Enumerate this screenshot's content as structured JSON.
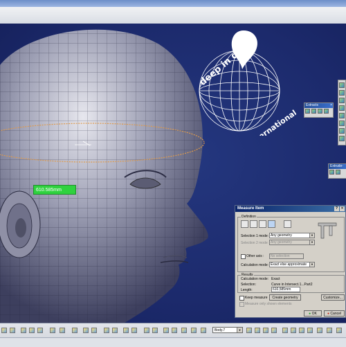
{
  "viewport": {
    "measure_tag": "610.585mm",
    "logo": {
      "text_top": "deep in dis",
      "text_bottom": "international"
    }
  },
  "toolbars": {
    "extracts": {
      "title": "Extracts"
    },
    "extrude": {
      "title": "Extrude-"
    }
  },
  "dialog": {
    "title": "Measure Item",
    "help_button": "?",
    "close_button": "×",
    "definition": {
      "label": "Definition",
      "selection1_mode_label": "Selection 1 mode:",
      "selection1_mode_value": "Any geometry",
      "selection2_mode_label": "Selection 2 mode:",
      "selection2_mode_value": "Any geometry",
      "other_axis_label": "Other axis :",
      "other_axis_value": "No selection",
      "calculation_mode_label": "Calculation mode:",
      "calculation_mode_value": "Exact else approximate"
    },
    "results": {
      "label": "Results",
      "calc_mode_label": "Calculation mode:",
      "calc_mode_value": "Exact",
      "selection_label": "Selection:",
      "selection_value": "Curve in Intersect.1...Part2",
      "length_label": "Length:",
      "length_value": "610,585mm"
    },
    "keep_measure_label": "Keep measure",
    "create_geometry_label": "Create geometry",
    "customize_label": "Customize...",
    "measure_only_shown_label": "Measure only shown elements",
    "ok_label": "OK",
    "cancel_label": "Cancel"
  },
  "statusbar": {
    "body_combo": "Body.7"
  }
}
